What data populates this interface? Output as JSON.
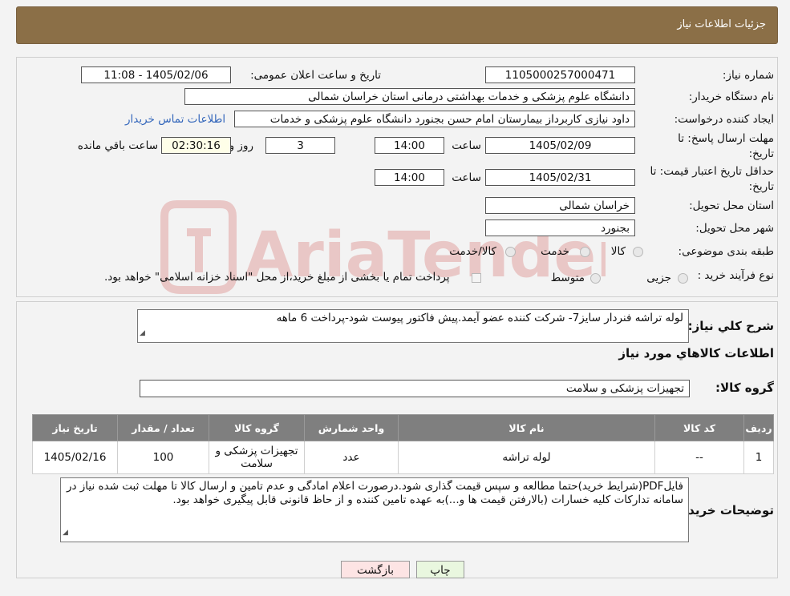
{
  "header": {
    "title": "جزئیات اطلاعات نیاز"
  },
  "need": {
    "number_label": "شماره نیاز:",
    "number": "1105000257000471",
    "announce_label": "تاریخ و ساعت اعلان عمومی:",
    "announce": "1405/02/06 - 11:08",
    "buyer_label": "نام دستگاه خریدار:",
    "buyer": "دانشگاه علوم پزشکی و خدمات بهداشتی درمانی استان خراسان شمالی",
    "creator_label": "ایجاد کننده درخواست:",
    "creator": "داود نیازی کاربرداز بیمارستان امام حسن بجنورد دانشگاه علوم پزشکی و خدمات",
    "contact_link": "اطلاعات تماس خریدار",
    "deadline_label_1": "مهلت ارسال پاسخ: تا",
    "deadline_label_2": "تاریخ:",
    "deadline_date": "1405/02/09",
    "time_label": "ساعت",
    "deadline_time": "14:00",
    "days": "3",
    "days_label": "روز و",
    "remaining": "02:30:16",
    "remaining_label": "ساعت باقي مانده",
    "validity_label_1": "حداقل تاریخ اعتبار قیمت: تا",
    "validity_label_2": "تاریخ:",
    "validity_date": "1405/02/31",
    "validity_time": "14:00",
    "province_label": "استان محل تحویل:",
    "province": "خراسان شمالی",
    "city_label": "شهر محل تحویل:",
    "city": "بجنورد",
    "category_label": "طبقه بندی موضوعی:",
    "category_options": [
      "کالا",
      "خدمت",
      "کالا/خدمت"
    ],
    "process_label": "نوع فرآیند خرید :",
    "process_options": [
      "جزیی",
      "متوسط"
    ],
    "process_note": "پرداخت تمام یا بخشی از مبلغ خرید،از محل \"اسناد خزانه اسلامی\" خواهد بود."
  },
  "watermark": "AriaTender.neT",
  "details": {
    "desc_label": "شرح کلي نیاز:",
    "desc": "لوله تراشه فنردار سایز7- شرکت کننده عضو آیمد.پیش فاکتور پیوست  شود-پرداخت 6 ماهه",
    "goods_info_title": "اطلاعات کالاهاي مورد نیاز",
    "group_label": "گروه کالا:",
    "group": "تجهیزات پزشکی و سلامت"
  },
  "table": {
    "headers": [
      "ردیف",
      "کد کالا",
      "نام کالا",
      "واحد شمارش",
      "گروه کالا",
      "تعداد / مقدار",
      "تاریخ نیاز"
    ],
    "rows": [
      [
        "1",
        "--",
        "لوله تراشه",
        "عدد",
        "تجهیزات پزشکی و سلامت",
        "100",
        "1405/02/16"
      ]
    ]
  },
  "notes": {
    "label": "توضیحات خریدار:",
    "text": "فایلPDF(شرایط خرید)حتما مطالعه و سپس قیمت گذاری شود.درصورت اعلام امادگی و عدم تامین و ارسال کالا تا مهلت ثبت شده نیاز در سامانه تدارکات کلیه خسارات (بالارفتن قیمت ها و...)به عهده تامین کننده و از حاظ قانونی قابل پیگیری خواهد بود."
  },
  "buttons": {
    "print": "چاپ",
    "back": "بازگشت"
  },
  "colors": {
    "header_bg": "#8b6f47",
    "table_header_bg": "#7f7f7f",
    "print_bg": "#e9f7df",
    "back_bg": "#fde4e4",
    "link": "#3366bb"
  }
}
